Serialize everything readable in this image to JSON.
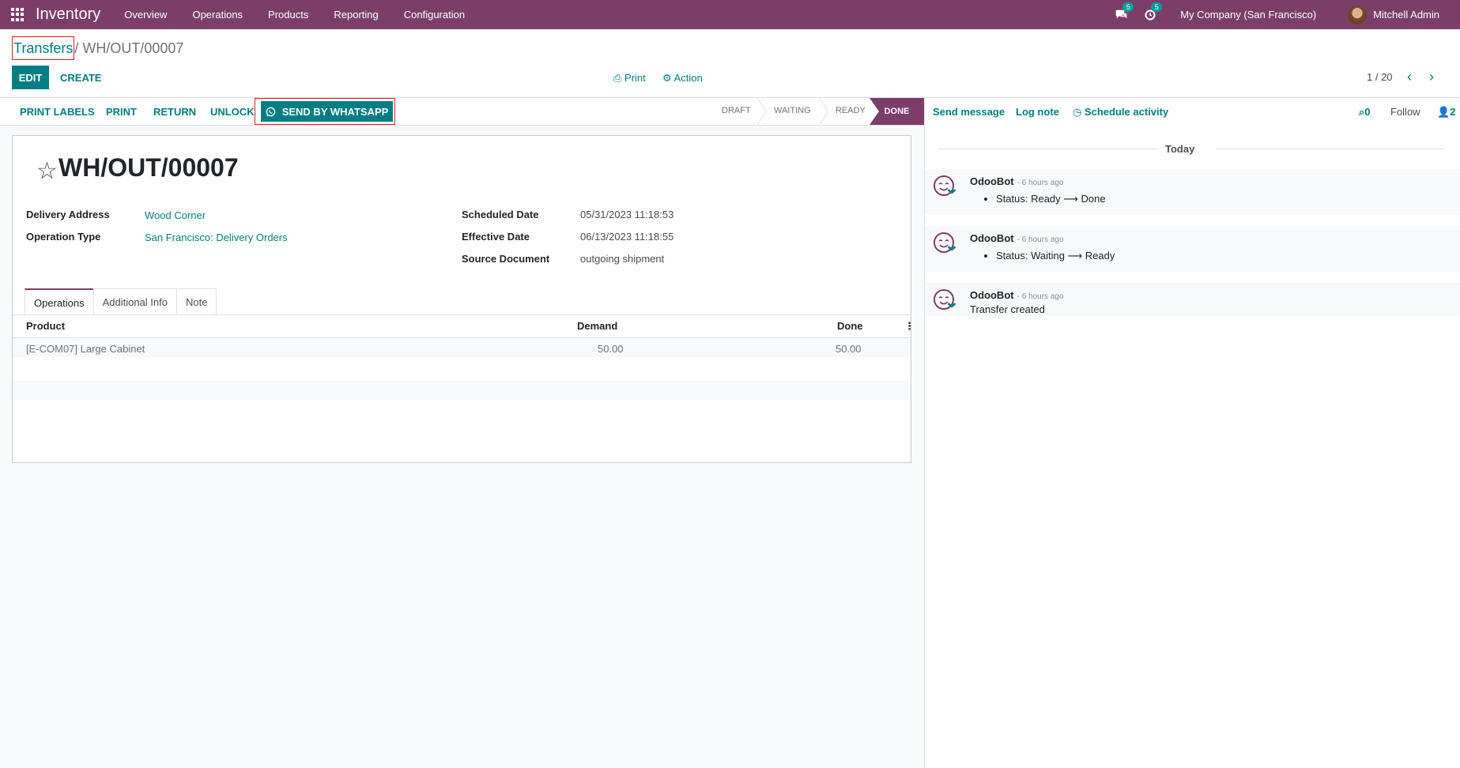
{
  "navbar": {
    "app_name": "Inventory",
    "menu": [
      "Overview",
      "Operations",
      "Products",
      "Reporting",
      "Configuration"
    ],
    "messages_badge": "5",
    "activities_badge": "5",
    "company": "My Company (San Francisco)",
    "user": "Mitchell Admin"
  },
  "breadcrumb": {
    "parent": "Transfers",
    "current": "/ WH/OUT/00007"
  },
  "control": {
    "edit": "EDIT",
    "create": "CREATE",
    "print": "Print",
    "action": "Action",
    "pager": "1 / 20"
  },
  "statusbar": {
    "buttons": [
      "PRINT LABELS",
      "PRINT",
      "RETURN",
      "UNLOCK"
    ],
    "whatsapp": "SEND BY WHATSAPP",
    "stages": [
      "DRAFT",
      "WAITING",
      "READY",
      "DONE"
    ],
    "current_stage": "DONE"
  },
  "form": {
    "title": "WH/OUT/00007",
    "fields_left": [
      {
        "label": "Delivery Address",
        "value": "Wood Corner"
      },
      {
        "label": "Operation Type",
        "value": "San Francisco: Delivery Orders"
      }
    ],
    "fields_right": [
      {
        "label": "Scheduled Date",
        "value": "05/31/2023 11:18:53"
      },
      {
        "label": "Effective Date",
        "value": "06/13/2023 11:18:55"
      },
      {
        "label": "Source Document",
        "value": "outgoing shipment"
      }
    ],
    "tabs": [
      "Operations",
      "Additional Info",
      "Note"
    ],
    "table": {
      "columns": [
        "Product",
        "Demand",
        "Done"
      ],
      "rows": [
        {
          "product": "[E-COM07] Large Cabinet",
          "demand": "50.00",
          "done": "50.00"
        }
      ]
    }
  },
  "chatter": {
    "send_message": "Send message",
    "log_note": "Log note",
    "schedule_activity": "Schedule activity",
    "attachments": "0",
    "follow": "Follow",
    "followers": "2",
    "date_separator": "Today",
    "messages": [
      {
        "author": "OdooBot",
        "time": "- 6 hours ago",
        "body": "Status: Ready ⟶ Done",
        "list": true
      },
      {
        "author": "OdooBot",
        "time": "- 6 hours ago",
        "body": "Status: Waiting ⟶ Ready",
        "list": true
      },
      {
        "author": "OdooBot",
        "time": "- 6 hours ago",
        "body": "Transfer created",
        "list": false
      }
    ]
  },
  "colors": {
    "brand": "#7c3e69",
    "accent": "#017e84",
    "highlight": "#e02020"
  }
}
